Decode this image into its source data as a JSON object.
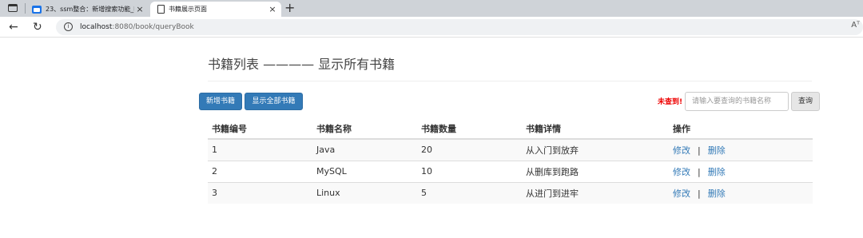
{
  "browser": {
    "tabs": [
      {
        "title": "23、ssm整合：新增搜索功能_咔",
        "active": false,
        "icon": "calendar-icon"
      },
      {
        "title": "书籍展示页面",
        "active": true,
        "icon": "page-icon"
      }
    ],
    "close_glyph": "×",
    "new_tab_glyph": "+",
    "url_host": "localhost",
    "url_rest": ":8080/book/queryBook",
    "reader_glyph": "Aᵀ",
    "accent": "#1a73e8"
  },
  "page": {
    "header": "书籍列表 ———— 显示所有书籍",
    "toolbar": {
      "add_label": "新增书籍",
      "show_all_label": "显示全部书籍",
      "not_found": "未查到!",
      "search_placeholder": "请输入要查询的书籍名称",
      "search_label": "查询"
    },
    "table": {
      "columns": [
        "书籍编号",
        "书籍名称",
        "书籍数量",
        "书籍详情",
        "操作"
      ],
      "rows": [
        {
          "id": "1",
          "name": "Java",
          "count": "20",
          "detail": "从入门到放弃"
        },
        {
          "id": "2",
          "name": "MySQL",
          "count": "10",
          "detail": "从删库到跑路"
        },
        {
          "id": "3",
          "name": "Linux",
          "count": "5",
          "detail": "从进门到进牢"
        }
      ],
      "edit_label": "修改",
      "separator": "|",
      "delete_label": "删除"
    },
    "colors": {
      "primary": "#337ab7",
      "warning": "#e00000"
    }
  }
}
